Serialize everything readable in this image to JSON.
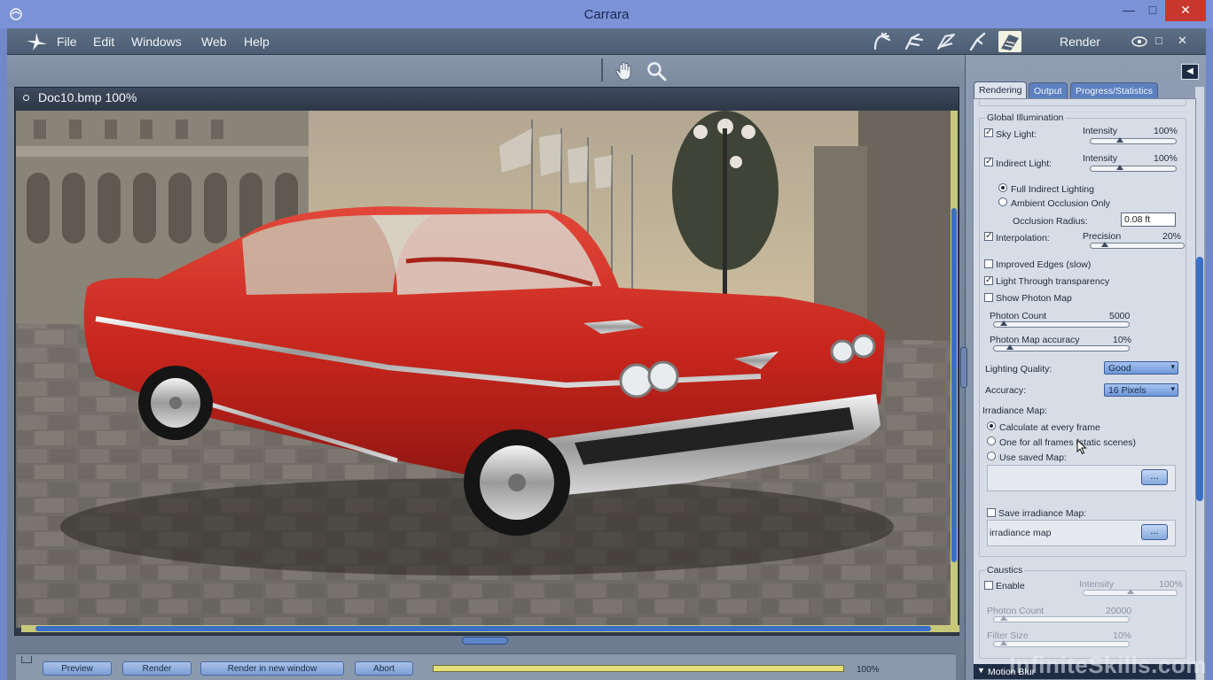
{
  "window": {
    "title": "Carrara",
    "minimize_glyph": "—",
    "maximize_glyph": "□",
    "close_glyph": "✕"
  },
  "menubar": {
    "items": [
      "File",
      "Edit",
      "Windows",
      "Web",
      "Help"
    ],
    "room_label": "Render",
    "room_icons": [
      "assemble-room-icon",
      "model-room-icon",
      "storyboard-room-icon",
      "texture-room-icon",
      "render-room-icon"
    ]
  },
  "toolbar": {
    "tools": [
      "hand-tool-icon",
      "zoom-tool-icon"
    ]
  },
  "document": {
    "title": "Doc10.bmp 100%",
    "image_description_icon": "rendered-car-image"
  },
  "bottombar": {
    "buttons": [
      "Preview",
      "Render",
      "Render in new window",
      "Abort"
    ],
    "progress_text": "100%",
    "progress": 1.0
  },
  "panel": {
    "tabs": [
      "Rendering",
      "Output",
      "Progress/Statistics"
    ],
    "active_tab": "Rendering",
    "collapse_glyph": "◀",
    "global_illumination": {
      "label": "Global Illumination",
      "sky_light": {
        "label": "Sky Light:",
        "checked": true,
        "intensity_label": "Intensity",
        "intensity_value": "100%",
        "level": 0.33
      },
      "indirect_light": {
        "label": "Indirect Light:",
        "checked": true,
        "intensity_label": "Intensity",
        "intensity_value": "100%",
        "level": 0.33
      },
      "full_indirect": {
        "label": "Full Indirect Lighting",
        "selected": true
      },
      "ambient_occlusion": {
        "label": "Ambient Occlusion Only",
        "selected": false
      },
      "occlusion_radius_label": "Occlusion Radius:",
      "occlusion_radius_value": "0.08 ft",
      "interpolation": {
        "label": "Interpolation:",
        "checked": true,
        "precision_label": "Precision",
        "precision_value": "20%",
        "level": 0.12
      },
      "improved_edges": {
        "label": "Improved Edges (slow)",
        "checked": false
      },
      "light_through": {
        "label": "Light Through transparency",
        "checked": true
      },
      "show_photon_map": {
        "label": "Show Photon Map",
        "checked": false
      },
      "photon_count": {
        "label": "Photon Count",
        "value": "5000",
        "level": 0.05
      },
      "photon_map_accuracy": {
        "label": "Photon Map accuracy",
        "value": "10%",
        "level": 0.1
      },
      "lighting_quality": {
        "label": "Lighting Quality:",
        "value": "Good"
      },
      "accuracy": {
        "label": "Accuracy:",
        "value": "16 Pixels"
      },
      "irradiance_map_label": "Irradiance Map:",
      "calc_every_frame": {
        "label": "Calculate at every frame",
        "selected": true
      },
      "one_for_all": {
        "label": "One for all frames (static scenes)",
        "selected": false
      },
      "use_saved": {
        "label": "Use saved Map:",
        "selected": false
      },
      "browse_glyph": "...",
      "save_irradiance": {
        "label": "Save irradiance Map:",
        "checked": false
      },
      "irradiance_map_file": "irradiance map"
    },
    "caustics": {
      "label": "Caustics",
      "enable": {
        "label": "Enable",
        "checked": false
      },
      "intensity_label": "Intensity",
      "intensity_value": "100%",
      "intensity_level": 0.5,
      "photon_count": {
        "label": "Photon Count",
        "value": "20000",
        "level": 0.05
      },
      "filter_size": {
        "label": "Filter Size",
        "value": "10%",
        "level": 0.05
      }
    },
    "motion_blur_label": "Motion Blur"
  },
  "watermark": "InfiniteSkills.com",
  "colors": {
    "titlebar": "#7b93d6",
    "accent": "#3b6ec8",
    "close": "#c7372e",
    "car": "#c8261d"
  }
}
